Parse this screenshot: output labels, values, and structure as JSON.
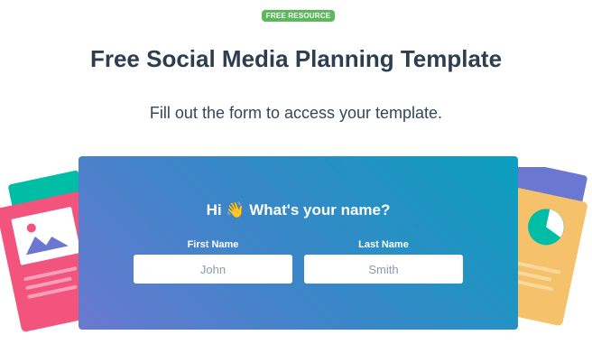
{
  "badge": "FREE RESOURCE",
  "title": "Free Social Media Planning Template",
  "subtitle": "Fill out the form to access your template.",
  "form": {
    "greeting": "Hi 👋 What's your name?",
    "first_name": {
      "label": "First Name",
      "placeholder": "John"
    },
    "last_name": {
      "label": "Last Name",
      "placeholder": "Smith"
    }
  },
  "colors": {
    "badge": "#5cb85c",
    "card_gradient": [
      "#0a9fbd",
      "#6a79cf"
    ],
    "left_card_pink": "#f2547d",
    "left_card_teal": "#00bda5",
    "right_card_yellow": "#f5c26b",
    "right_card_purple": "#6a78d1"
  }
}
